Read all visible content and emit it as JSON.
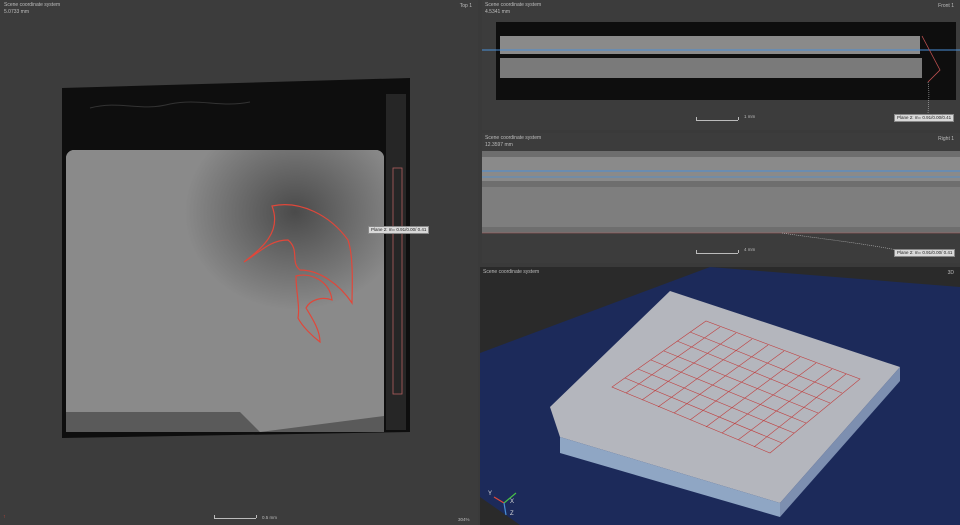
{
  "top_view": {
    "coord_system": "Scene coordinate system",
    "value": "5.0733 mm",
    "view_name": "Top 1",
    "plane_tag": "Plane 2: m= 0.91/0.00/ 0.41",
    "scale_label": "0.5 mm",
    "zoom": "304%"
  },
  "front_view": {
    "coord_system": "Scene coordinate system",
    "value": "4.5341 mm",
    "view_name": "Front 1",
    "plane_tag": "Plane 2: m= 0.91/0.00/0.41",
    "scale_label": "1 mm"
  },
  "right_view": {
    "coord_system": "Scene coordinate system",
    "value": "12.3597 mm",
    "view_name": "Right 1",
    "plane_tag": "Plane 2: m= 0.91/0.00/ 0.41",
    "scale_label": "4 mm"
  },
  "view_3d": {
    "coord_system": "Scene coordinate system",
    "view_name": "3D",
    "axes": {
      "y": "Y",
      "x": "X",
      "z": "Z"
    }
  },
  "colors": {
    "annotation": "#e0473a",
    "plane": "#4a8fd6",
    "bg_3d": "#1c2a5a"
  }
}
